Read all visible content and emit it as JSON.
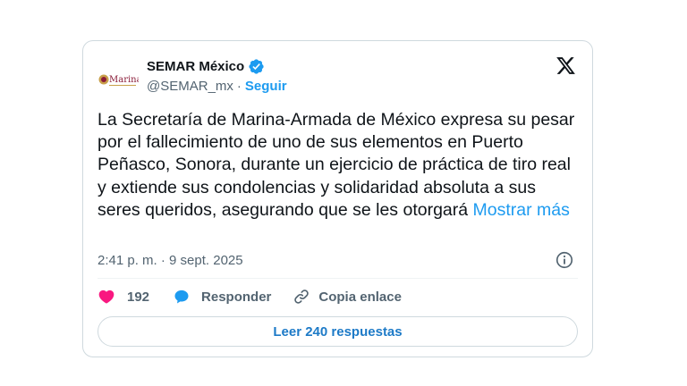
{
  "author": {
    "display_name": "SEMAR México",
    "handle": "@SEMAR_mx",
    "separator": "·",
    "follow_label": "Seguir",
    "avatar_text": "Marina"
  },
  "tweet": {
    "text": "La Secretaría de Marina-Armada de México expresa su pesar por el fallecimiento de uno de sus elementos en Puerto Peñasco, Sonora, durante un ejercicio de práctica de tiro real y extiende sus condolencias y solidaridad absoluta a sus seres queridos, asegurando que se les otorgará ",
    "show_more": "Mostrar más",
    "timestamp": "2:41 p. m. · 9 sept. 2025"
  },
  "actions": {
    "like_count": "192",
    "reply_label": "Responder",
    "copy_link_label": "Copia enlace"
  },
  "replies_button": "Leer 240 respuestas",
  "colors": {
    "accent": "#1d9bf0",
    "like": "#f91880",
    "text": "#0f1419",
    "muted": "#536471"
  },
  "icons": [
    "avatar-logo",
    "verified-badge-icon",
    "x-logo-icon",
    "info-icon",
    "heart-icon",
    "reply-bubble-icon",
    "link-icon"
  ]
}
